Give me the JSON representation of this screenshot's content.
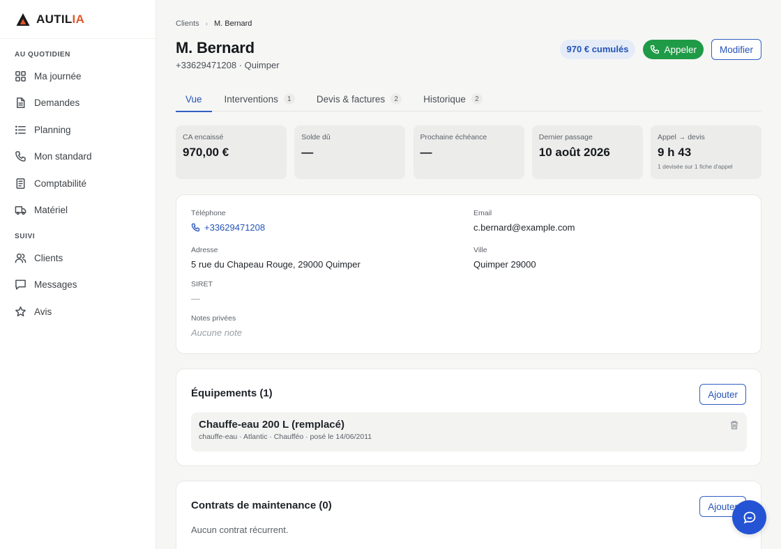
{
  "app": {
    "logo_text_main": "AUTIL",
    "logo_text_accent": "IA",
    "accent_color": "#e2562a",
    "primary_color": "#2453b8",
    "success_color": "#1f9a46"
  },
  "sidebar": {
    "sections": [
      {
        "title": "AU QUOTIDIEN",
        "items": [
          {
            "label": "Ma journée",
            "icon": "grid-icon"
          },
          {
            "label": "Demandes",
            "icon": "document-icon"
          },
          {
            "label": "Planning",
            "icon": "list-icon"
          },
          {
            "label": "Mon standard",
            "icon": "phone-icon"
          },
          {
            "label": "Comptabilité",
            "icon": "receipt-icon"
          },
          {
            "label": "Matériel",
            "icon": "truck-icon"
          }
        ]
      },
      {
        "title": "SUIVI",
        "items": [
          {
            "label": "Clients",
            "icon": "users-icon"
          },
          {
            "label": "Messages",
            "icon": "message-icon"
          },
          {
            "label": "Avis",
            "icon": "star-icon"
          }
        ]
      }
    ]
  },
  "breadcrumb": {
    "parent": "Clients",
    "separator": "›",
    "current": "M. Bernard"
  },
  "header": {
    "title": "M. Bernard",
    "subtitle": "+33629471208 · Quimper",
    "cumulative_badge": "970 € cumulés",
    "call_button": "Appeler",
    "edit_button": "Modifier"
  },
  "tabs": [
    {
      "label": "Vue",
      "count": null,
      "active": true
    },
    {
      "label": "Interventions",
      "count": "1",
      "active": false
    },
    {
      "label": "Devis & factures",
      "count": "2",
      "active": false
    },
    {
      "label": "Historique",
      "count": "2",
      "active": false
    }
  ],
  "stats": [
    {
      "label": "CA encaissé",
      "value": "970,00 €",
      "note": ""
    },
    {
      "label": "Solde dû",
      "value": "—",
      "note": ""
    },
    {
      "label": "Prochaine échéance",
      "value": "—",
      "note": ""
    },
    {
      "label": "Dernier passage",
      "value": "10 août 2026",
      "note": ""
    },
    {
      "label": "Appel → devis",
      "value": "9 h 43",
      "note": "1 devisée sur 1 fiche d'appel"
    }
  ],
  "info": {
    "phone_label": "Téléphone",
    "phone_value": "+33629471208",
    "email_label": "Email",
    "email_value": "c.bernard@example.com",
    "address_label": "Adresse",
    "address_value": "5 rue du Chapeau Rouge, 29000 Quimper",
    "city_label": "Ville",
    "city_value": "Quimper 29000",
    "siret_label": "SIRET",
    "siret_value": "—",
    "notes_label": "Notes privées",
    "notes_value": "Aucune note"
  },
  "equipment": {
    "title": "Équipements (1)",
    "add_button": "Ajouter",
    "items": [
      {
        "name": "Chauffe-eau 200 L (remplacé)",
        "meta": "chauffe-eau · Atlantic · Chaufféo · posé le 14/06/2011"
      }
    ]
  },
  "maintenance": {
    "title": "Contrats de maintenance (0)",
    "add_button": "Ajouter",
    "empty_text": "Aucun contrat récurrent."
  }
}
